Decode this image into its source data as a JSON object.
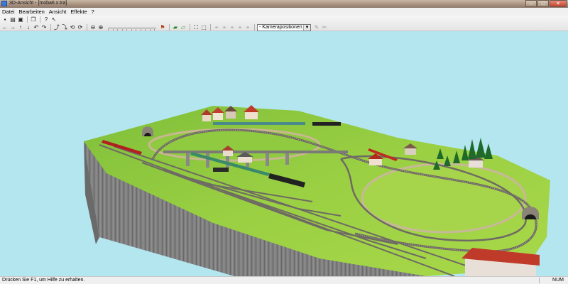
{
  "window": {
    "title": "3D-Ansicht - [moba6.x.tra]",
    "buttons": [
      "–",
      "□",
      "✕"
    ]
  },
  "menu": [
    "Datei",
    "Bearbeiten",
    "Ansicht",
    "Effekte",
    "?"
  ],
  "toolbar": {
    "camera_select": "- Kamerapositionen"
  },
  "status": {
    "message": "Drücken Sie F1, um Hilfe zu erhalten.",
    "num": "NUM"
  },
  "colors": {
    "sky": "#b4e6f0",
    "grass": "#8cc83c",
    "base": "#8a8a8a",
    "track": "#6e6a64"
  }
}
